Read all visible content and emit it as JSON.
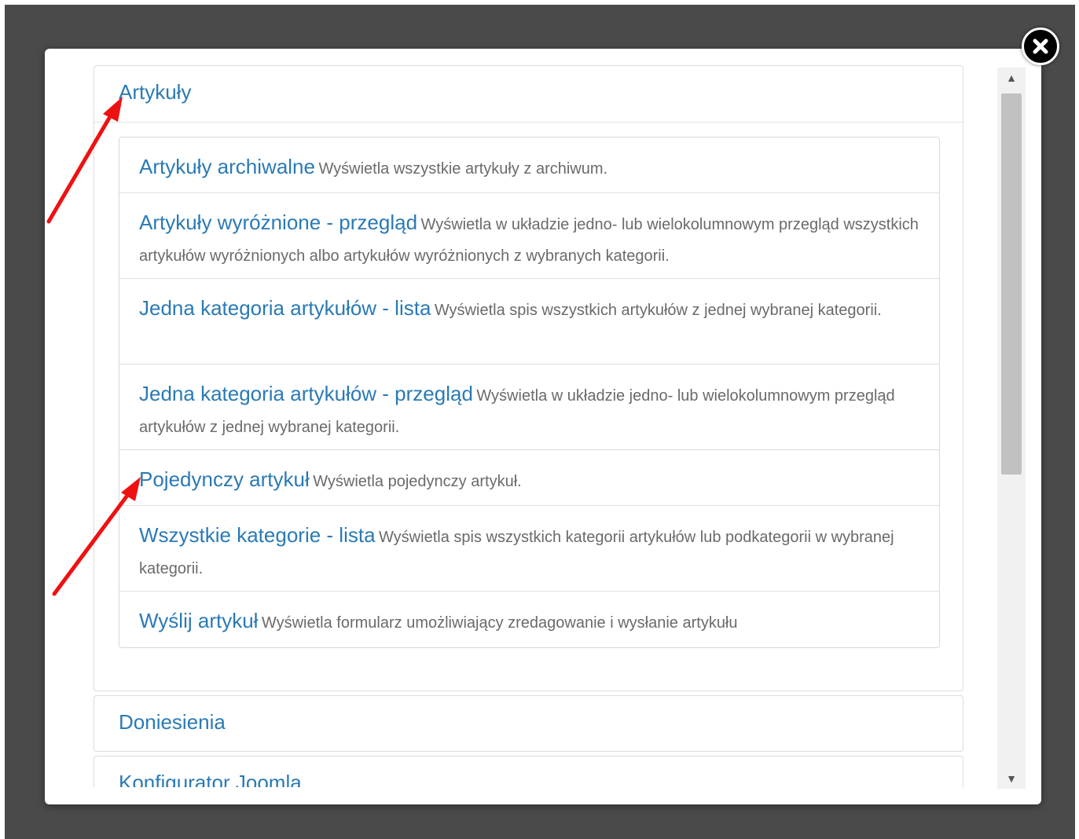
{
  "modal": {
    "sections": [
      {
        "title": "Artykuły",
        "items": [
          {
            "title": "Artykuły archiwalne",
            "desc": "Wyświetla wszystkie artykuły z archiwum."
          },
          {
            "title": "Artykuły wyróżnione - przegląd",
            "desc": "Wyświetla w układzie jedno- lub wielokolumnowym przegląd wszystkich artykułów wyróżnionych albo artykułów wyróżnionych z wybranych kategorii."
          },
          {
            "title": "Jedna kategoria artykułów - lista",
            "desc": "Wyświetla spis wszystkich artykułów z jednej wybranej kategorii."
          },
          {
            "title": "Jedna kategoria artykułów - przegląd",
            "desc": "Wyświetla w układzie jedno- lub wielokolumnowym przegląd artykułów z jednej wybranej kategorii."
          },
          {
            "title": "Pojedynczy artykuł",
            "desc": "Wyświetla pojedynczy artykuł."
          },
          {
            "title": "Wszystkie kategorie - lista",
            "desc": "Wyświetla spis wszystkich kategorii artykułów lub podkategorii w wybranej kategorii."
          },
          {
            "title": "Wyślij artykuł",
            "desc": "Wyświetla formularz umożliwiający zredagowanie i wysłanie artykułu"
          }
        ]
      },
      {
        "title": "Doniesienia"
      },
      {
        "title": "Konfigurator Joomla"
      }
    ]
  },
  "icons": {
    "close": "close-icon",
    "scroll_up": "arrow-up-icon",
    "scroll_down": "arrow-down-icon",
    "annotation": "red-arrow-icon"
  },
  "colors": {
    "link": "#2a7ab5",
    "description": "#6a6a6a",
    "backdrop": "#4a4a4a",
    "annotation": "#ee1111"
  }
}
